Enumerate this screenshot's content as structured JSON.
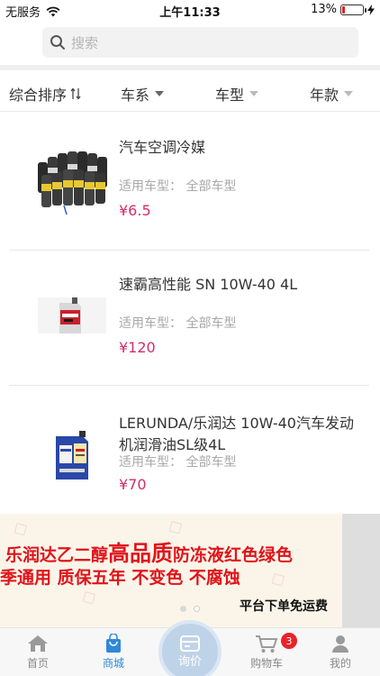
{
  "status_bar": {
    "carrier": "无服务",
    "time": "上午11:33",
    "battery_percent_text": "13%",
    "battery_level": 0.13,
    "battery_color": "#e02020"
  },
  "search": {
    "placeholder": "搜索",
    "icon": "search-icon"
  },
  "filters": {
    "sort_label": "综合排序",
    "sort_icon": "sort-arrows-icon",
    "series_label": "车系",
    "model_label": "车型",
    "year_label": "年款"
  },
  "products": [
    {
      "title": "汽车空调冷媒",
      "fit_label": "适用车型：",
      "fit_value": "全部车型",
      "price": "¥6.5",
      "thumb": "refrigerant-cans-image"
    },
    {
      "title": "速霸高性能 SN 10W-40 4L",
      "fit_label": "适用车型：",
      "fit_value": "全部车型",
      "price": "¥120",
      "thumb": "engine-oil-jug-image"
    },
    {
      "title": " LERUNDA/乐润达 10W-40汽车发动机润滑油SL级4L",
      "fit_label": "适用车型：",
      "fit_value": "全部车型",
      "price": "¥70",
      "thumb": "lubricant-jug-image"
    }
  ],
  "banner": {
    "line1_pre": "乐润达乙二醇",
    "line1_big": "高品质",
    "line1_post": "防冻液红色绿色",
    "line2": "季通用  质保五年  不变色  不腐蚀",
    "line3": "平台下单免运费",
    "slide_count": 2,
    "active_slide": 2
  },
  "tabbar": {
    "home": "首页",
    "mall": "商城",
    "inquiry": "询价",
    "cart": "购物车",
    "cart_badge": "3",
    "mine": "我的",
    "active_color": "#2e89d6",
    "price_color": "#d22e6a"
  }
}
